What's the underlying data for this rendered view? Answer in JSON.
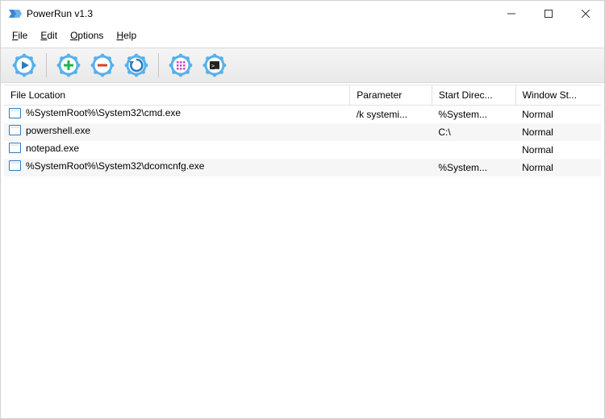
{
  "window": {
    "title": "PowerRun v1.3"
  },
  "menubar": {
    "items": [
      {
        "label": "File",
        "hotkey": "F"
      },
      {
        "label": "Edit",
        "hotkey": "E"
      },
      {
        "label": "Options",
        "hotkey": "O"
      },
      {
        "label": "Help",
        "hotkey": "H"
      }
    ]
  },
  "toolbar": {
    "buttons": [
      {
        "name": "run-gear-icon",
        "inner": "play",
        "innerColor": "#2b7bc1"
      },
      {
        "sep": true
      },
      {
        "name": "add-gear-icon",
        "inner": "plus",
        "innerColor": "#24b34b"
      },
      {
        "name": "remove-gear-icon",
        "inner": "minus",
        "innerColor": "#d93f2b"
      },
      {
        "name": "refresh-gear-icon",
        "inner": "arc",
        "innerColor": "#2b7bc1"
      },
      {
        "sep": true
      },
      {
        "name": "color-gear-icon",
        "inner": "grid",
        "innerColor": "#d83fc2"
      },
      {
        "name": "cmd-gear-icon",
        "inner": "cmd",
        "innerColor": "#222222"
      }
    ]
  },
  "table": {
    "headers": {
      "file_location": "File Location",
      "parameter": "Parameter",
      "start_dir": "Start Direc...",
      "window_state": "Window St..."
    },
    "rows": [
      {
        "file": "%SystemRoot%\\System32\\cmd.exe",
        "parameter": "/k systemi...",
        "start_dir": "%System...",
        "window_state": "Normal"
      },
      {
        "file": "powershell.exe",
        "parameter": "",
        "start_dir": "C:\\",
        "window_state": "Normal"
      },
      {
        "file": "notepad.exe",
        "parameter": "",
        "start_dir": "",
        "window_state": "Normal"
      },
      {
        "file": "%SystemRoot%\\System32\\dcomcnfg.exe",
        "parameter": "",
        "start_dir": "%System...",
        "window_state": "Normal"
      }
    ]
  }
}
